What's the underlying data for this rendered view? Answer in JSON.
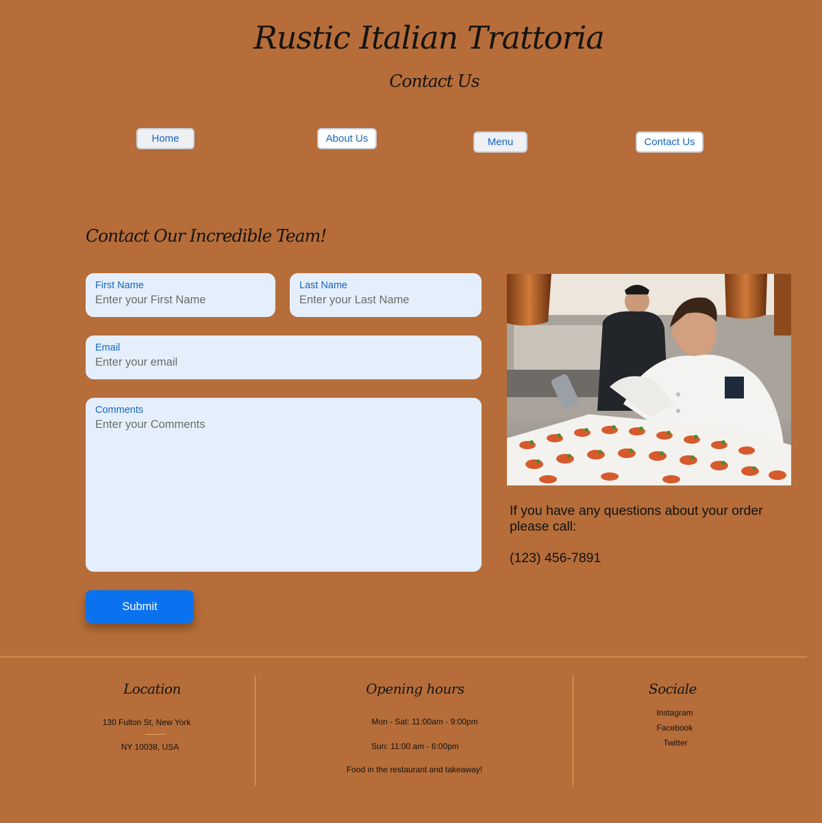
{
  "header": {
    "title": "Rustic Italian Trattoria",
    "subtitle": "Contact Us"
  },
  "nav": {
    "home": "Home",
    "about": "About Us",
    "menu": "Menu",
    "contact": "Contact Us"
  },
  "form": {
    "heading": "Contact Our Incredible Team!",
    "first_name": {
      "label": "First Name",
      "placeholder": "Enter your First Name"
    },
    "last_name": {
      "label": "Last Name",
      "placeholder": "Enter your Last Name"
    },
    "email": {
      "label": "Email",
      "placeholder": "Enter your email"
    },
    "comments": {
      "label": "Comments",
      "placeholder": "Enter your Comments"
    },
    "submit": "Submit"
  },
  "aside": {
    "order_text": "If you have any questions about your order please call:",
    "phone": "(123) 456-7891"
  },
  "footer": {
    "location": {
      "heading": "Location",
      "line1": "130 Fulton St,   New York",
      "line2": "NY 10038, USA"
    },
    "hours": {
      "heading": "Opening hours",
      "line1": "Mon - Sat: 11:00am - 9:00pm",
      "line2": "Sun: 11:00 am - 6:00pm",
      "note": "Food in the restaurant and takeaway!"
    },
    "socials": {
      "heading": "Sociale",
      "links": [
        "Instagram",
        "Facebook",
        "Twitter"
      ]
    }
  },
  "colors": {
    "background": "#b66d39",
    "accent": "#0a72ee",
    "field_bg": "#e5effc",
    "link_blue": "#1565c0"
  }
}
